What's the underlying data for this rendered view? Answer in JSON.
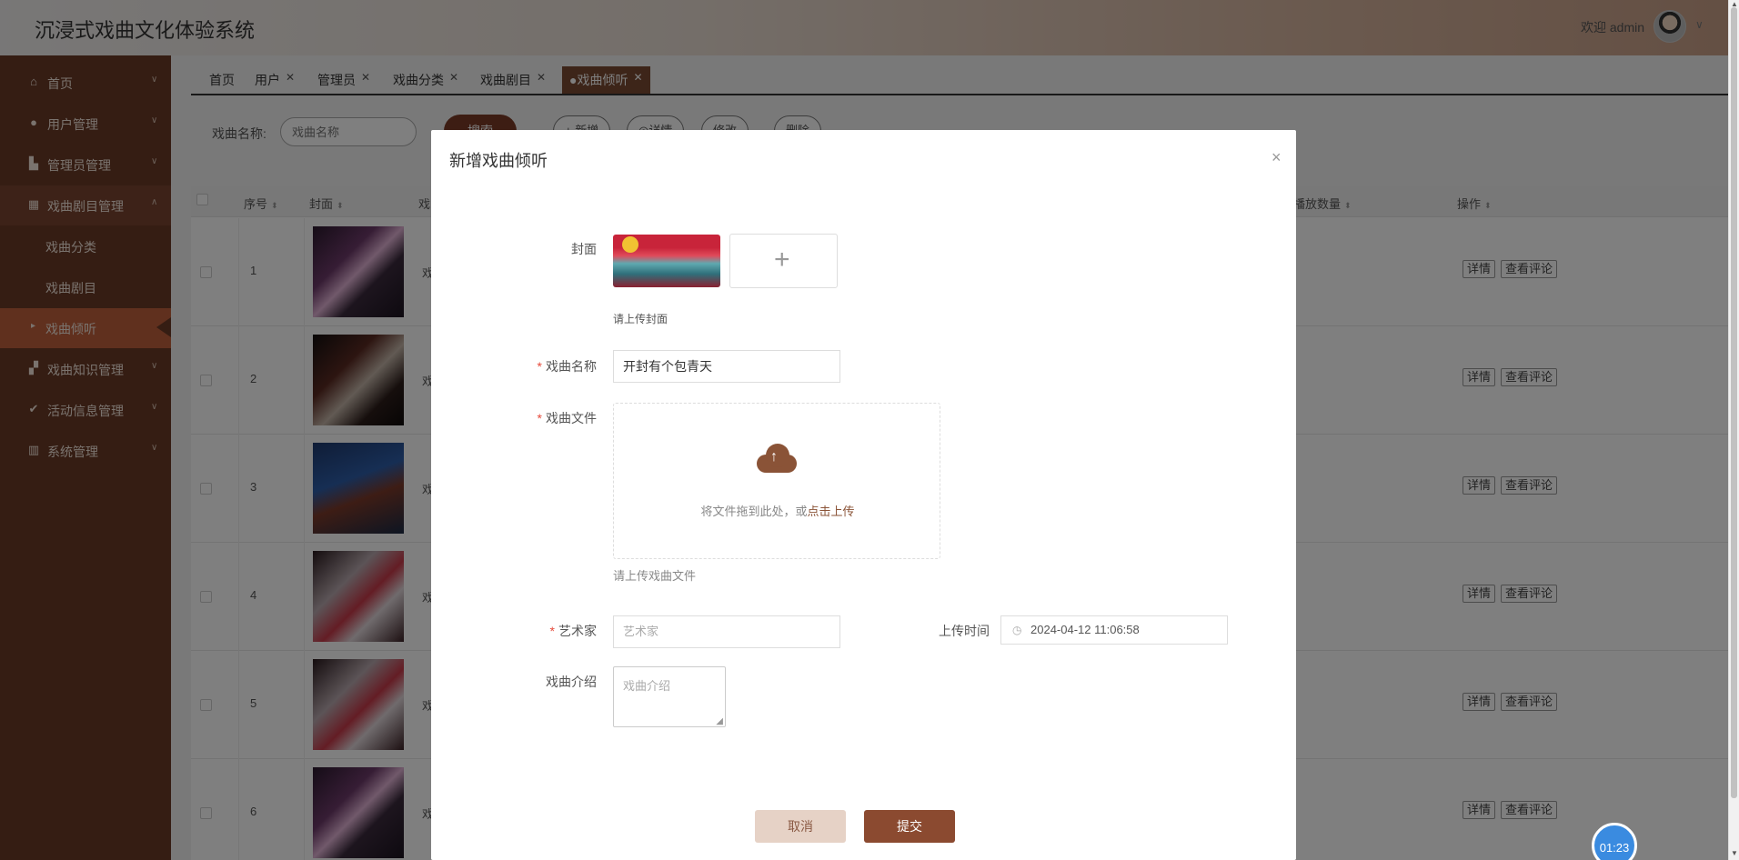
{
  "header": {
    "title": "沉浸式戏曲文化体验系统",
    "welcome": "欢迎 admin"
  },
  "sidebar": {
    "items": [
      {
        "label": "首页",
        "icon": "home-icon"
      },
      {
        "label": "用户管理",
        "icon": "user-icon"
      },
      {
        "label": "管理员管理",
        "icon": "building-icon"
      },
      {
        "label": "戏曲剧目管理",
        "icon": "grid-icon"
      },
      {
        "label": "戏曲知识管理",
        "icon": "book-icon"
      },
      {
        "label": "活动信息管理",
        "icon": "check-circle-icon"
      },
      {
        "label": "系统管理",
        "icon": "chart-icon"
      }
    ],
    "subitems": [
      "戏曲分类",
      "戏曲剧目",
      "戏曲倾听"
    ]
  },
  "tabs": [
    {
      "label": "首页"
    },
    {
      "label": "用户"
    },
    {
      "label": "管理员"
    },
    {
      "label": "戏曲分类"
    },
    {
      "label": "戏曲剧目"
    },
    {
      "label": "●戏曲倾听"
    }
  ],
  "search": {
    "label": "戏曲名称:",
    "placeholder": "戏曲名称",
    "button": "搜索"
  },
  "toolbar": {
    "add": "+ 新增",
    "detail": "◎详情",
    "edit": "修改",
    "delete": "删除"
  },
  "table": {
    "headers": [
      "序号",
      "封面",
      "戏",
      "播放数量",
      "操作"
    ],
    "rows": [
      {
        "no": "1",
        "frag": "戏"
      },
      {
        "no": "2",
        "frag": "戏"
      },
      {
        "no": "3",
        "frag": "戏"
      },
      {
        "no": "4",
        "frag": "戏"
      },
      {
        "no": "5",
        "frag": "戏"
      },
      {
        "no": "6",
        "frag": "戏"
      }
    ],
    "op_detail": "详情",
    "op_comments": "查看评论"
  },
  "modal": {
    "title": "新增戏曲倾听",
    "close": "×",
    "cover_label": "封面",
    "cover_hint": "请上传封面",
    "name_label": "戏曲名称",
    "name_value": "开封有个包青天",
    "file_label": "戏曲文件",
    "upload_text_a": "将文件拖到此处，或",
    "upload_text_b": "点击上传",
    "file_hint": "请上传戏曲文件",
    "artist_label": "艺术家",
    "artist_placeholder": "艺术家",
    "upload_time_label": "上传时间",
    "upload_time_value": "2024-04-12 11:06:58",
    "intro_label": "戏曲介绍",
    "intro_placeholder": "戏曲介绍",
    "cancel": "取消",
    "submit": "提交"
  },
  "timer": "01:23",
  "colors": {
    "sidebar_bg": "#6b3a27",
    "active_menu": "#c0613d",
    "primary": "#8b4a30",
    "required": "#e64a3b"
  }
}
